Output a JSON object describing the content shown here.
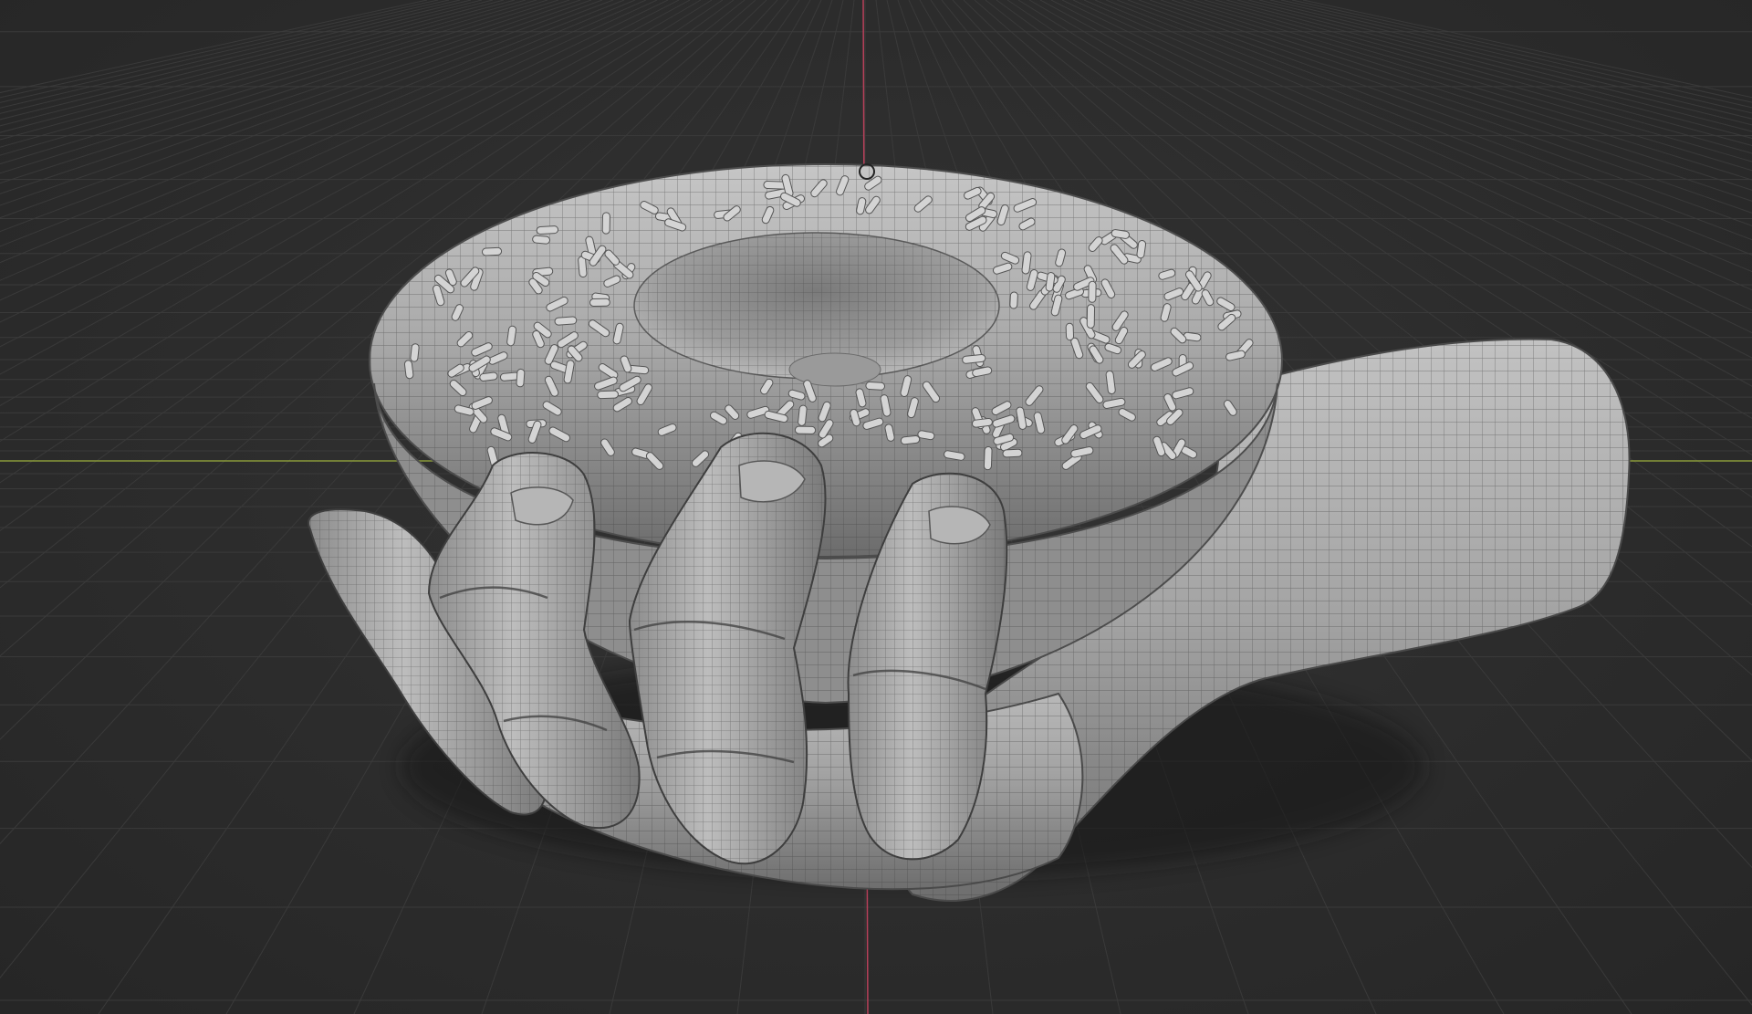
{
  "viewport": {
    "mode": "3d-viewport",
    "shading": "solid-wireframe-overlay",
    "objects": [
      "donut",
      "sprinkles",
      "hand"
    ],
    "colors": {
      "background": "#2b2b2b",
      "grid": "#3a3a3a",
      "x_axis": "#8a9a3a",
      "y_axis": "#b8405a",
      "mesh_base": "#9a9a9a",
      "mesh_highlight": "#c9c9c9",
      "mesh_shadow": "#5e5e5e",
      "wire": "#3f3f3f",
      "sprinkle": "#d4d4d4"
    }
  }
}
